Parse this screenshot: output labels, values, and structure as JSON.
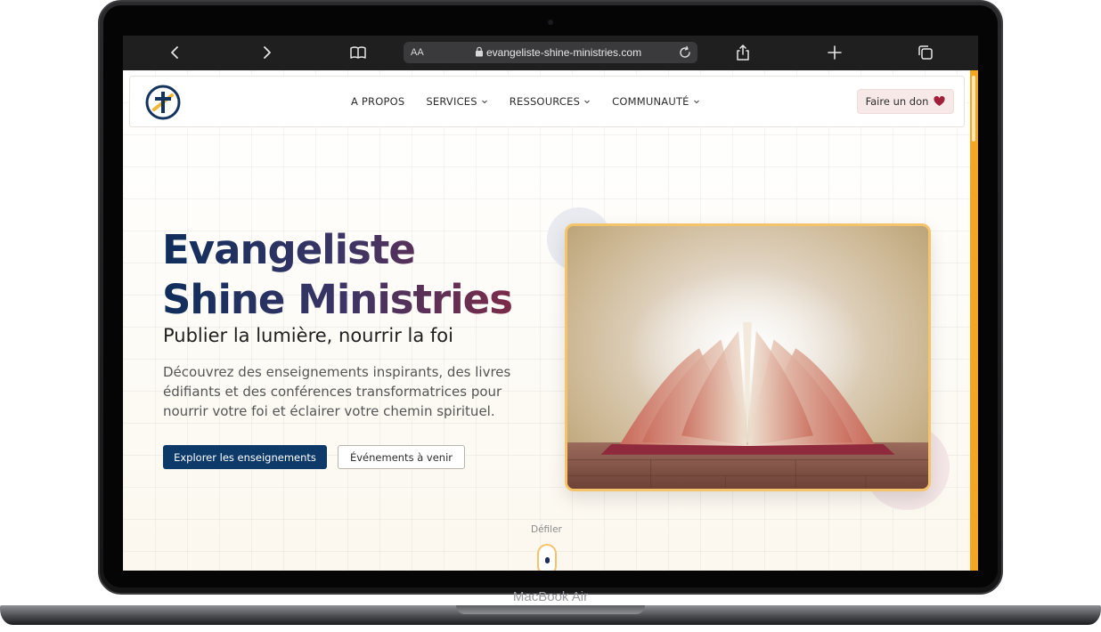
{
  "device": {
    "label": "MacBook Air"
  },
  "browser": {
    "aa_label": "AA",
    "url": "evangeliste-shine-ministries.com",
    "icons": [
      "back-icon",
      "forward-icon",
      "bookmarks-icon",
      "lock-icon",
      "reload-icon",
      "share-icon",
      "new-tab-icon",
      "tabs-icon"
    ]
  },
  "nav": {
    "logo_icon": "cross-logo-icon",
    "links": [
      {
        "label": "A PROPOS",
        "has_dropdown": false
      },
      {
        "label": "SERVICES",
        "has_dropdown": true
      },
      {
        "label": "RESSOURCES",
        "has_dropdown": true
      },
      {
        "label": "COMMUNAUTÉ",
        "has_dropdown": true
      }
    ],
    "donate_label": "Faire un don",
    "donate_icon": "heart-icon"
  },
  "hero": {
    "title_line1": "Evangeliste",
    "title_line2": "Shine Ministries",
    "subtitle": "Publier la lumière, nourrir la foi",
    "description": "Découvrez des enseignements inspirants, des livres édifiants et des conférences transformatrices pour nourrir votre foi et éclairer votre chemin spirituel.",
    "primary_button": "Explorer les enseignements",
    "secondary_button": "Événements à venir",
    "image_subject": "open-book"
  },
  "scroll_hint": {
    "label": "Défiler"
  },
  "colors": {
    "brand_navy": "#0e3a6a",
    "brand_burgundy": "#8b2a42",
    "accent_gold": "#f5c46a",
    "scrollbar": "#f4a623",
    "heart": "#a2213a"
  }
}
